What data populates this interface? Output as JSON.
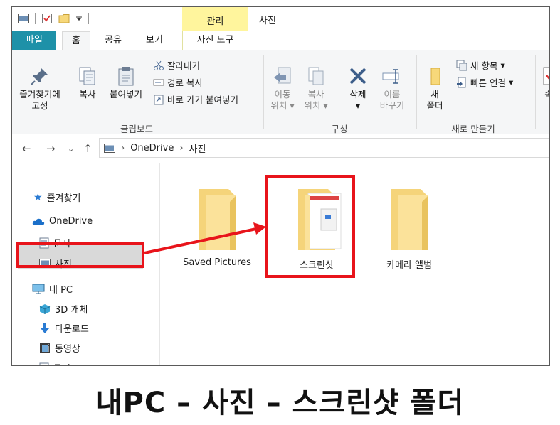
{
  "window": {
    "title": "사진",
    "contextual_group_label": "관리"
  },
  "tabs": [
    {
      "label": "파일"
    },
    {
      "label": "홈"
    },
    {
      "label": "공유"
    },
    {
      "label": "보기"
    },
    {
      "label": "사진 도구"
    }
  ],
  "ribbon": {
    "clipboard": {
      "pin_label_1": "즐겨찾기에",
      "pin_label_2": "고정",
      "copy_label": "복사",
      "paste_label": "붙여넣기",
      "cut_label": "잘라내기",
      "copy_path_label": "경로 복사",
      "paste_shortcut_label": "바로 가기 붙여넣기",
      "group_label": "클립보드"
    },
    "organize": {
      "move_to_1": "이동",
      "move_to_2": "위치",
      "copy_to_1": "복사",
      "copy_to_2": "위치",
      "delete_label": "삭제",
      "rename_1": "이름",
      "rename_2": "바꾸기",
      "group_label": "구성"
    },
    "new": {
      "new_folder_1": "새",
      "new_folder_2": "폴더",
      "new_item_label": "새 항목",
      "easy_access_label": "빠른 연결",
      "group_label": "새로 만들기"
    },
    "cut_off_label": "속"
  },
  "address": {
    "path": [
      "OneDrive",
      "사진"
    ]
  },
  "sidebar": {
    "items": [
      {
        "label": "즐겨찾기"
      },
      {
        "label": "OneDrive"
      },
      {
        "label": "문서"
      },
      {
        "label": "사진"
      },
      {
        "label": "내 PC"
      },
      {
        "label": "3D 개체"
      },
      {
        "label": "다운로드"
      },
      {
        "label": "동영상"
      },
      {
        "label": "문서"
      }
    ]
  },
  "folders": [
    {
      "name": "Saved Pictures"
    },
    {
      "name": "스크린샷"
    },
    {
      "name": "카메라 앨범"
    }
  ],
  "caption": "내PC – 사진 – 스크린샷 폴더",
  "colors": {
    "file_tab": "#1e91a8",
    "context_group": "#fff59d",
    "highlight": "#e8141b",
    "folder": "#f7d87a",
    "selection": "#d9d9d9"
  }
}
